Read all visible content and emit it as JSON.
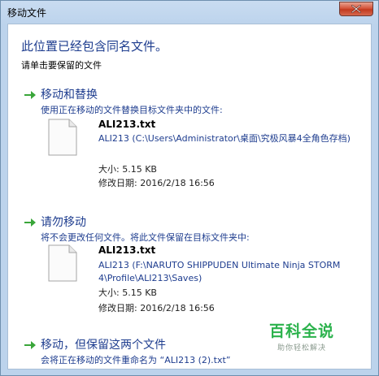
{
  "window": {
    "title": "移动文件"
  },
  "dialog": {
    "headline": "此位置已经包含同名文件。",
    "subhead": "请单击要保留的文件"
  },
  "options": [
    {
      "title": "移动和替换",
      "description": "使用正在移动的文件替换目标文件夹中的文件:",
      "file": {
        "name": "ALI213.txt",
        "path": "ALI213 (C:\\Users\\Administrator\\桌面\\究极风暴4全角色存档)",
        "size": "大小: 5.15 KB",
        "modified": "修改日期: 2016/2/18 16:56"
      }
    },
    {
      "title": "请勿移动",
      "description": "将不会更改任何文件。将此文件保留在目标文件夹中:",
      "file": {
        "name": "ALI213.txt",
        "path": "ALI213 (F:\\NARUTO SHIPPUDEN Ultimate Ninja STORM 4\\Profile\\ALI213\\Saves)",
        "size": "大小: 5.15 KB",
        "modified": "修改日期: 2016/2/18 16:56"
      }
    },
    {
      "title": "移动，但保留这两个文件",
      "description": "会将正在移动的文件重命名为 “ALI213 (2).txt”"
    }
  ],
  "watermark": {
    "main": "百科全说",
    "sub": "助你轻松解决"
  },
  "colors": {
    "accent_text": "#1e3d8f",
    "arrow_green": "#3aa63a",
    "close_red": "#c23a1f",
    "watermark_green": "#2bb24c"
  },
  "icons": {
    "close": "close-icon",
    "option_arrow": "green-arrow-icon",
    "file": "text-file-icon"
  }
}
